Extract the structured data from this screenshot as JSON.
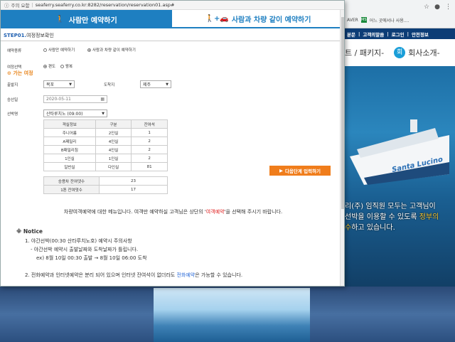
{
  "browser": {
    "bookmarks": [
      "AVER",
      "어느 곳에서나 사용...."
    ],
    "bookmark_icon": "MS"
  },
  "background_site": {
    "nav": [
      "분문",
      "고객의말씀",
      "로그인",
      "안전정보"
    ],
    "sub_text": "트 / 패키지-",
    "company_label": "회사소개-",
    "company_icon": "회",
    "ship_name": "Santa Lucino",
    "hero_line1": "리(주) 임직원 모두는 고객님이",
    "hero_line2_a": "선박을 이용할 수 있도록 ",
    "hero_line2_hl": "정부의",
    "hero_line3_a": "수",
    "hero_line3_b": "하고 있습니다."
  },
  "popup": {
    "security": "주의 요함",
    "url": "seaferry.seaferry.co.kr:8282/reservation/reservation01.asp#",
    "tab_passenger": "사람만 예약하기",
    "tab_vehicle": "사람과 차량 같이 예약하기",
    "step_label": "STEP01.",
    "step_title": "여정정보확인",
    "form": {
      "type_label": "예약종류",
      "type_opt1": "사람만 예약하기",
      "type_opt2": "사람과 차량 같이 예약하기",
      "trip_label": "여정선택",
      "trip_opt1": "편도",
      "trip_opt2": "왕복",
      "section_title": "가는 여정",
      "depart_label": "출발지",
      "depart_value": "목포",
      "arrive_label": "도착지",
      "arrive_value": "제주",
      "date_label": "승선일",
      "date_value": "2020-05-11",
      "ship_label": "선박명",
      "ship_value": "산타루치노 (09:00)"
    },
    "cabin_table": {
      "headers": [
        "객실정보",
        "구분",
        "잔여석"
      ],
      "rows": [
        [
          "주니어룸",
          "2인실",
          "1"
        ],
        [
          "A패밀리",
          "4인실",
          "2"
        ],
        [
          "B패밀리침",
          "4인실",
          "2"
        ],
        [
          "1인실",
          "1인실",
          "2"
        ],
        [
          "일반실",
          "다인실",
          "81"
        ]
      ]
    },
    "count_table": {
      "rows": [
        [
          "승용차 잔여댓수",
          "23"
        ],
        [
          "1톤 잔여댓수",
          "17"
        ]
      ]
    },
    "next_button": "다음단계 입력하기",
    "message_a": "차량여객예약에 대한 메뉴입니다. 여객만 예약하실 고객님은 상단의 '",
    "message_red": "여객예약",
    "message_b": "'을 선택해 주시기 바랍니다.",
    "notice_title": "※ Notice",
    "notice_1": "1. 야간선박(00:30 산타루치노호) 예약시 주의사항",
    "notice_1a": "- 야간선박 예약시 출발날짜와 도착날짜가 틀립니다.",
    "notice_1b": "ex) 8월 10일 00:30 출발 → 8월 10일 06:00 도착",
    "notice_2a": "2. 전화예약과 인터넷예약은 분리 되어 있으며 인터넷 잔여석이 없더라도 ",
    "notice_2_blue": "전화예약",
    "notice_2b": "은 가능할 수 있습니다."
  }
}
